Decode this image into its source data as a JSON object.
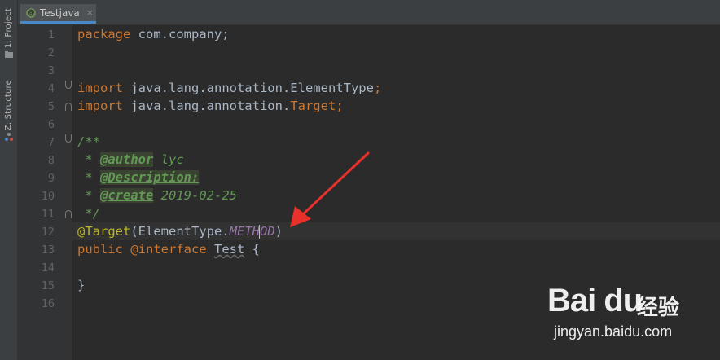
{
  "side_tools": {
    "project_label": "1: Project",
    "structure_label": "Z: Structure"
  },
  "tab": {
    "label": "Testjava",
    "icon": "@",
    "close": "×"
  },
  "line_numbers": [
    "1",
    "2",
    "3",
    "4",
    "5",
    "6",
    "7",
    "8",
    "9",
    "10",
    "11",
    "12",
    "13",
    "14",
    "15",
    "16"
  ],
  "code": {
    "l1_kw": "package",
    "l1_rest": " com.company;",
    "l4_kw": "import",
    "l4_rest": " java.lang.annotation.ElementType",
    "l4_semi": ";",
    "l5_kw": "import",
    "l5_rest": " java.lang.annotation.",
    "l5_cls": "Target",
    "l5_semi": ";",
    "l7_doc": "/**",
    "l8_pre": " * ",
    "l8_tag": "@author",
    "l8_val": " lyc",
    "l9_pre": " * ",
    "l9_tag": "@Description:",
    "l10_pre": " * ",
    "l10_tag": "@create",
    "l10_val": " 2019-02-25",
    "l11_doc": " */",
    "l12_anno": "@Target",
    "l12_open": "(ElementType.",
    "l12_const_a": "METH",
    "l12_const_b": "OD",
    "l12_close": ")",
    "l13_kw1": "public",
    "l13_kw2": " @interface",
    "l13_sp": " ",
    "l13_name": "Test",
    "l13_brace": " {",
    "l15_brace": "}"
  },
  "watermark": {
    "brand": "Bai du",
    "cn": "经验",
    "url": "jingyan.baidu.com"
  },
  "colors": {
    "background": "#2b2b2b",
    "keyword": "#cc7832",
    "doc_comment": "#629755",
    "constant": "#9876aa",
    "arrow": "#e8312a"
  }
}
